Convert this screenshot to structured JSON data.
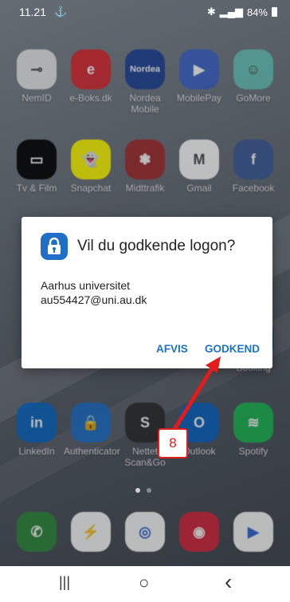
{
  "status_bar": {
    "time": "11.21",
    "battery": "84%"
  },
  "home_apps": [
    {
      "label": "NemID",
      "color": "#e8e8e8",
      "glyph": "⊸"
    },
    {
      "label": "e-Boks.dk",
      "color": "#d6272e",
      "glyph": "e"
    },
    {
      "label": "Nordea Mobile",
      "color": "#1c3f95",
      "glyph": "Nordea"
    },
    {
      "label": "MobilePay",
      "color": "#3a63c7",
      "glyph": "▶"
    },
    {
      "label": "GoMore",
      "color": "#66c2b8",
      "glyph": "☺"
    },
    {
      "label": "Tv & Film",
      "color": "#000000",
      "glyph": "▭"
    },
    {
      "label": "Snapchat",
      "color": "#fffc00",
      "glyph": "👻"
    },
    {
      "label": "Midttrafik",
      "color": "#a02b2b",
      "glyph": "❃"
    },
    {
      "label": "Gmail",
      "color": "#ffffff",
      "glyph": "M"
    },
    {
      "label": "Facebook",
      "color": "#3b5998",
      "glyph": "f"
    },
    {
      "label": "LinkedIn",
      "color": "#0a66c2",
      "glyph": "in"
    },
    {
      "label": "Authenticator",
      "color": "#1f6fc8",
      "glyph": "🔒"
    },
    {
      "label": "Nettet Scan&Go",
      "color": "#2b2b2b",
      "glyph": "S"
    },
    {
      "label": "Outlook",
      "color": "#0a64c2",
      "glyph": "O"
    },
    {
      "label": "Spotify",
      "color": "#1db954",
      "glyph": "≋"
    },
    {
      "label": "Booking",
      "color": "#003580",
      "glyph": "B"
    }
  ],
  "dock_apps": [
    {
      "label": "Phone",
      "color": "#2e8b3c",
      "glyph": "✆"
    },
    {
      "label": "Messenger",
      "color": "#ffffff",
      "glyph": "⚡"
    },
    {
      "label": "Chrome",
      "color": "#ffffff",
      "glyph": "◎"
    },
    {
      "label": "Camera",
      "color": "#d6273d",
      "glyph": "◉"
    },
    {
      "label": "Play Store",
      "color": "#ffffff",
      "glyph": "▶"
    }
  ],
  "dialog": {
    "title": "Vil du godkende logon?",
    "organization": "Aarhus universitet",
    "account": "au554427@uni.au.dk",
    "reject_label": "AFVIS",
    "approve_label": "GODKEND",
    "icon": "authenticator-lock-icon"
  },
  "annotation": {
    "step": "8",
    "color": "#e21b1b"
  },
  "navbar": {
    "recent": "|||",
    "home": "○",
    "back": "‹"
  }
}
